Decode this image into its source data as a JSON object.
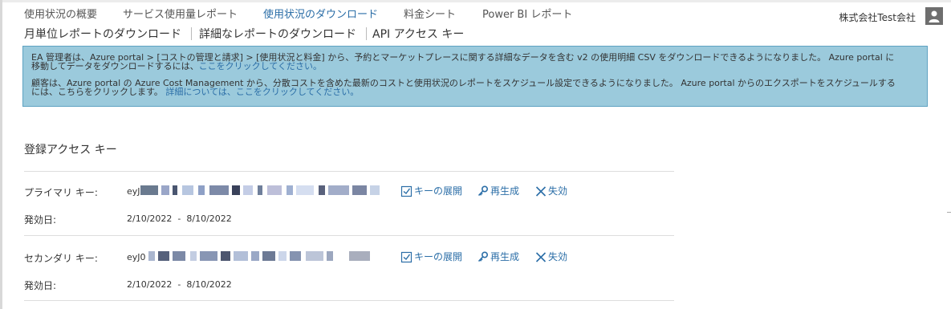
{
  "nav": {
    "tabs": [
      {
        "label": "使用状況の概要"
      },
      {
        "label": "サービス使用量レポート"
      },
      {
        "label": "使用状況のダウンロード"
      },
      {
        "label": "料金シート"
      },
      {
        "label": "Power BI レポート"
      }
    ],
    "active_index": 2,
    "account_name": "株式会社Test会社"
  },
  "subnav": {
    "items": [
      {
        "label": "月単位レポートのダウンロード"
      },
      {
        "label": "詳細なレポートのダウンロード"
      },
      {
        "label": "API アクセス キー"
      }
    ]
  },
  "banner": {
    "line1_text": "EA 管理者は、Azure portal > [コストの管理と請求] > [使用状況と料金] から、予約とマーケットプレースに関する詳細なデータを含む v2 の使用明細 CSV をダウンロードできるようになりました。 Azure portal に",
    "line2_text": "移動してデータをダウンロードするには、",
    "line2_link": "ここをクリックしてください。",
    "line3_text": "顧客は、Azure portal の Azure Cost Management から、分散コストを含めた最新のコストと使用状況のレポートをスケジュール設定できるようになりました。 Azure portal からのエクスポートをスケジュールする",
    "line4_text": "には、",
    "line4_link1": "こちらをクリックします。",
    "line4_link2": "詳細については、ここをクリックしてください。"
  },
  "access_keys": {
    "section_title": "登録アクセス キー",
    "date_label": "発効日:",
    "expand_label": "キーの展開",
    "regenerate_label": "再生成",
    "revoke_label": "失効",
    "primary": {
      "label": "プライマリ キー:",
      "key_prefix": "eyJ",
      "start_date": "2/10/2022",
      "date_sep": "-",
      "end_date": "8/10/2022"
    },
    "secondary": {
      "label": "セカンダリ キー:",
      "key_prefix": "eyJ0",
      "start_date": "2/10/2022",
      "date_sep": "-",
      "end_date": "8/10/2022"
    }
  },
  "colors": {
    "link": "#2b6ea7",
    "banner_bg": "#9bcadc",
    "banner_border": "#5ea2c2",
    "avatar_bg": "#6e6e6e"
  },
  "icons": [
    "user-avatar-icon",
    "checkbox-expand-icon",
    "key-icon",
    "close-x-icon"
  ]
}
